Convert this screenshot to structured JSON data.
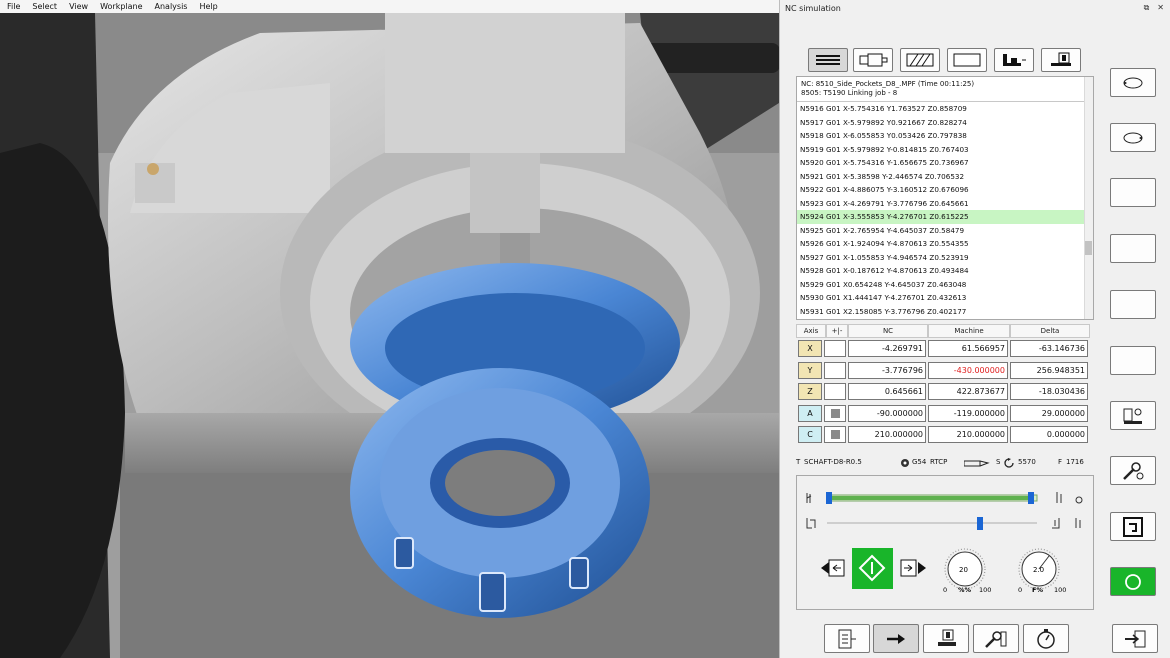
{
  "menu": [
    "File",
    "Select",
    "View",
    "Workplane",
    "Analysis",
    "Help"
  ],
  "panel": {
    "title": "NC simulation",
    "ctrl_restore": "⧉",
    "ctrl_close": "✕"
  },
  "toolbar_top": [
    {
      "icon": "lines-icon"
    },
    {
      "icon": "machine-view-icon"
    },
    {
      "icon": "hatch-icon"
    },
    {
      "icon": "blank-rect-icon"
    },
    {
      "icon": "machine-table-icon"
    },
    {
      "icon": "tool-change-icon"
    }
  ],
  "nc": {
    "header1": "NC: 8510_Side_Pockets_D8_.MPF (Time 00:11:25)",
    "header2": "8505: T5190 Linking job - 8",
    "lines": [
      "N5916 G01 X-5.754316 Y1.763527 Z0.858709",
      "N5917 G01 X-5.979892 Y0.921667 Z0.828274",
      "N5918 G01 X-6.055853 Y0.053426 Z0.797838",
      "N5919 G01 X-5.979892 Y-0.814815 Z0.767403",
      "N5920 G01 X-5.754316 Y-1.656675 Z0.736967",
      "N5921 G01 X-5.38598 Y-2.446574 Z0.706532",
      "N5922 G01 X-4.886075 Y-3.160512 Z0.676096",
      "N5923 G01 X-4.269791 Y-3.776796 Z0.645661",
      "N5924 G01 X-3.555853 Y-4.276701 Z0.615225",
      "N5925 G01 X-2.765954 Y-4.645037 Z0.58479",
      "N5926 G01 X-1.924094 Y-4.870613 Z0.554355",
      "N5927 G01 X-1.055853 Y-4.946574 Z0.523919",
      "N5928 G01 X-0.187612 Y-4.870613 Z0.493484",
      "N5929 G01 X0.654248 Y-4.645037 Z0.463048",
      "N5930 G01 X1.444147 Y-4.276701 Z0.432613",
      "N5931 G01 X2.158085 Y-3.776796 Z0.402177"
    ],
    "highlight_index": 8
  },
  "axes": {
    "headers": {
      "axis": "Axis",
      "toggle": "+|-",
      "nc": "NC",
      "machine": "Machine",
      "delta": "Delta"
    },
    "rows": [
      {
        "axis": "X",
        "kind": "lin",
        "nc": "-4.269791",
        "machine": "61.566957",
        "delta": "-63.146736",
        "machine_red": false
      },
      {
        "axis": "Y",
        "kind": "lin",
        "nc": "-3.776796",
        "machine": "-430.000000",
        "delta": "256.948351",
        "machine_red": true
      },
      {
        "axis": "Z",
        "kind": "lin",
        "nc": "0.645661",
        "machine": "422.873677",
        "delta": "-18.030436",
        "machine_red": false
      },
      {
        "axis": "A",
        "kind": "rot",
        "nc": "-90.000000",
        "machine": "-119.000000",
        "delta": "29.000000",
        "machine_red": false
      },
      {
        "axis": "C",
        "kind": "rot",
        "nc": "210.000000",
        "machine": "210.000000",
        "delta": "0.000000",
        "machine_red": false
      }
    ]
  },
  "status": {
    "tool_prefix": "T",
    "tool": "SCHAFT-D8-R0.5",
    "g54": "G54",
    "rtcp": "RTCP",
    "s_label": "S",
    "s_value": "5570",
    "f_label": "F",
    "f_value": "1716"
  },
  "controls": {
    "speed_dial": {
      "value": "20",
      "min": "0",
      "max": "100",
      "unit": "%%"
    },
    "feed_dial": {
      "value": "2.0",
      "min": "0",
      "max": "100",
      "unit": "F%"
    },
    "play_color": "#19b52a",
    "progress_fraction": 0.97
  },
  "side_buttons": [
    {
      "icon": "rotate-view-icon"
    },
    {
      "icon": "rotate-view-icon"
    },
    {
      "icon": "empty-icon"
    },
    {
      "icon": "empty-icon"
    },
    {
      "icon": "empty-icon"
    },
    {
      "icon": "empty-icon"
    },
    {
      "icon": "machine-settings-icon"
    },
    {
      "icon": "wrench-gear-icon"
    },
    {
      "icon": "single-step-icon"
    },
    {
      "icon": "run-circle-icon"
    }
  ],
  "bottom_buttons": [
    {
      "icon": "report-icon"
    },
    {
      "icon": "goto-icon"
    },
    {
      "icon": "tool-icon"
    },
    {
      "icon": "settings-icon"
    },
    {
      "icon": "stopwatch-icon"
    },
    {
      "icon": "exit-icon"
    }
  ],
  "colors": {
    "part": "#4a86d4",
    "machine": "#cfcfcf",
    "highlight": "#c8f5c3",
    "active_button": "#19b52a"
  }
}
